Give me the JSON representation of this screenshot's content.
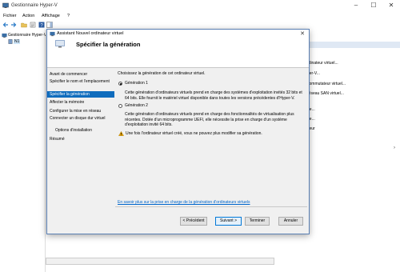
{
  "main_window": {
    "title": "Gestionnaire Hyper-V",
    "menu": [
      "Fichier",
      "Action",
      "Affichage",
      "?"
    ],
    "tree": {
      "root": "Gestionnaire Hyper-V",
      "child": "N1"
    },
    "actions": [
      "rdinateur virtuel...",
      "per-V...",
      "commutateur virtuel...",
      "réseau SAN virtuel...",
      "ue...",
      "ue...",
      "veur"
    ]
  },
  "dialog": {
    "title": "Assistant Nouvel ordinateur virtuel",
    "heading": "Spécifier la génération",
    "steps": [
      "Avant de commencer",
      "Spécifier le nom et l'emplacement",
      "Spécifier la génération",
      "Affecter la mémoire",
      "Configurer la mise en réseau",
      "Connecter un disque dur virtuel",
      "Options d'installation",
      "Résumé"
    ],
    "active_step": 2,
    "intro": "Choisissez la génération de cet ordinateur virtuel.",
    "gen1": {
      "label": "Génération 1",
      "description": "Cette génération d'ordinateurs virtuels prend en charge des systèmes d'exploitation invités 32 bits et 64 bits. Elle fournit le matériel virtuel disponible dans toutes les versions précédentes d'Hyper-V.",
      "selected": true
    },
    "gen2": {
      "label": "Génération 2",
      "description": "Cette génération d'ordinateurs virtuels prend en charge des fonctionnalités de virtualisation plus récentes. Dotée d'un microprogramme UEFI, elle nécessite la prise en charge d'un système d'exploitation invité 64 bits.",
      "selected": false
    },
    "warning": "Une fois l'ordinateur virtuel créé, vous ne pouvez plus modifier sa génération.",
    "link": "En savoir plus sur la prise en charge de la génération d'ordinateurs virtuels",
    "buttons": {
      "previous": "< Précédent",
      "next": "Suivant >",
      "finish": "Terminer",
      "cancel": "Annuler"
    }
  },
  "colors": {
    "accent": "#0f6cbd",
    "link": "#0066cc",
    "warning": "#e8a400"
  }
}
